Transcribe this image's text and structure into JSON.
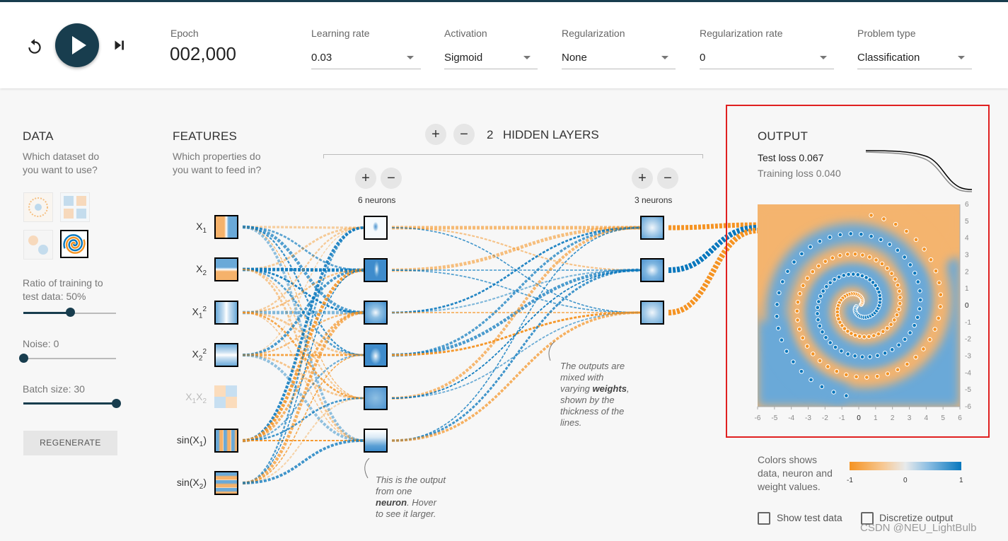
{
  "controls": {
    "epoch_label": "Epoch",
    "epoch_value": "002,000",
    "learning_rate": {
      "label": "Learning rate",
      "value": "0.03"
    },
    "activation": {
      "label": "Activation",
      "value": "Sigmoid"
    },
    "regularization": {
      "label": "Regularization",
      "value": "None"
    },
    "regularization_rate": {
      "label": "Regularization rate",
      "value": "0"
    },
    "problem_type": {
      "label": "Problem type",
      "value": "Classification"
    }
  },
  "data_panel": {
    "title": "DATA",
    "subtitle_line1": "Which dataset do",
    "subtitle_line2": "you want to use?",
    "ratio_line1": "Ratio of training to",
    "ratio_line2": "test data:  50%",
    "ratio_value": 0.5,
    "noise_label": "Noise:  0",
    "noise_value": 0,
    "batch_label": "Batch size:  30",
    "batch_value": 1.0,
    "regenerate": "REGENERATE"
  },
  "features_panel": {
    "title": "FEATURES",
    "subtitle_line1": "Which properties do",
    "subtitle_line2": "you want to feed in?",
    "features": [
      {
        "main": "X",
        "sub": "1",
        "sup": "",
        "tail": ""
      },
      {
        "main": "X",
        "sub": "2",
        "sup": "",
        "tail": ""
      },
      {
        "main": "X",
        "sub": "1",
        "sup": "2",
        "tail": ""
      },
      {
        "main": "X",
        "sub": "2",
        "sup": "2",
        "tail": ""
      },
      {
        "main": "X",
        "sub": "1",
        "sup": "",
        "tail": "X",
        "sub2": "2"
      },
      {
        "main": "sin(X",
        "sub": "1",
        "sup": "",
        "tail": ")"
      },
      {
        "main": "sin(X",
        "sub": "2",
        "sup": "",
        "tail": ")"
      }
    ]
  },
  "network": {
    "plus": "+",
    "minus": "−",
    "hidden_count": "2",
    "hidden_label": "HIDDEN LAYERS",
    "layer1_label": "6 neurons",
    "layer2_label": "3 neurons",
    "annotation_weights_1": "The outputs are",
    "annotation_weights_2": "mixed with",
    "annotation_weights_3a": "varying ",
    "annotation_weights_3b": "weights",
    "annotation_weights_3c": ",",
    "annotation_weights_4": "shown by the",
    "annotation_weights_5": "thickness of the",
    "annotation_weights_6": "lines.",
    "annotation_neuron_1": "This is the output",
    "annotation_neuron_2": "from one",
    "annotation_neuron_3a": "neuron",
    "annotation_neuron_3b": ". Hover",
    "annotation_neuron_4": "to see it larger."
  },
  "output_panel": {
    "title": "OUTPUT",
    "test_loss": "Test loss 0.067",
    "training_loss": "Training loss 0.040",
    "axis_ticks": [
      "-6",
      "-5",
      "-4",
      "-3",
      "-2",
      "-1",
      "0",
      "1",
      "2",
      "3",
      "4",
      "5",
      "6"
    ],
    "legend_line1": "Colors shows",
    "legend_line2": "data, neuron and",
    "legend_line3": "weight values.",
    "legend_min": "-1",
    "legend_mid": "0",
    "legend_max": "1",
    "show_test_data": "Show test data",
    "discretize_output": "Discretize output"
  },
  "colors": {
    "orange": "#f59322",
    "blue": "#0877bd",
    "dark": "#183d4e",
    "highlight": "#e02020"
  },
  "watermark": "CSDN @NEU_LightBulb"
}
